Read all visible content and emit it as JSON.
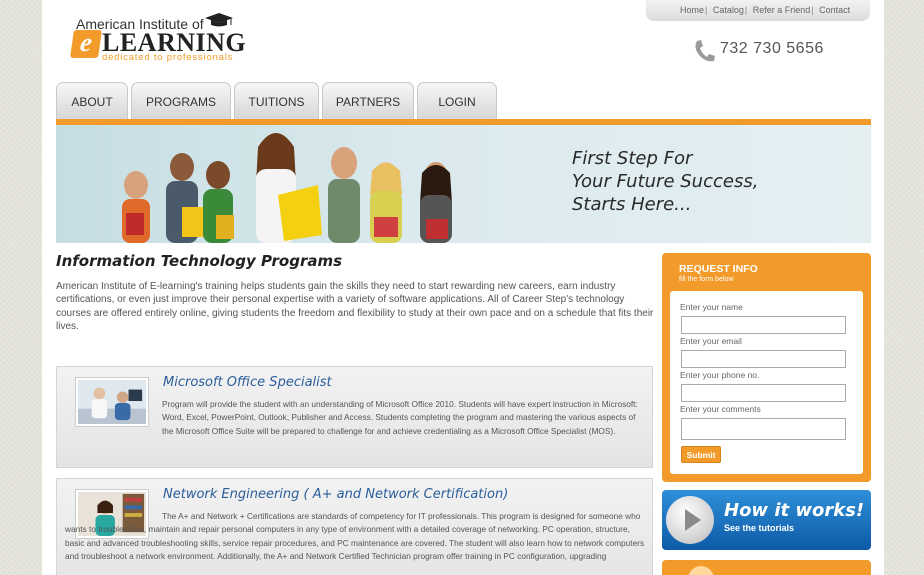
{
  "logo": {
    "top": "American Institute of",
    "e": "e",
    "main": "LEARNING",
    "sub": "dedicated to professionals"
  },
  "top_links": [
    "Home",
    "Catalog",
    "Refer a Friend",
    "Contact"
  ],
  "top_link_separator": "|",
  "phone": "732 730 5656",
  "nav": [
    "ABOUT",
    "PROGRAMS",
    "TUITIONS",
    "PARTNERS",
    "LOGIN"
  ],
  "banner": {
    "line1": "First Step For",
    "line2": "Your Future Success,",
    "line3": "Starts Here..."
  },
  "main": {
    "title": "Information Technology Programs",
    "intro": "American Institute of E-learning's training helps students gain the skills they need to start rewarding new careers, earn industry certifications, or even just improve their personal expertise with a variety of software applications. All of Career Step's technology courses are offered entirely online, giving students the freedom and flexibility to study at their own pace and on a schedule that fits their lives."
  },
  "programs": [
    {
      "title": "Microsoft Office Specialist",
      "desc": "Program will provide the student with an understanding of Microsoft Office 2010. Students will have expert instruction in Microsoft: Word, Excel, PowerPoint, Outlook, Publisher and Access. Students completing the program and mastering the various aspects of the Microsoft Office Suite will be prepared to challenge for and achieve credentialing as a Microsoft Office Specialist (MOS)."
    },
    {
      "title": "Network Engineering ( A+ and Network Certification)",
      "desc": "The A+ and Network + Certifications are standards of competency for IT professionals. This program is designed for someone who wants to troubleshoot, maintain and repair personal computers in any type of environment with a detailed coverage of networking. PC operation, structure, basic and advanced troubleshooting skills, service repair procedures, and PC maintenance are covered. The student will also learn how to network computers and troubleshoot a network environment. Additionally, the A+ and Network Certified Technician program offer training in PC configuration, upgrading"
    }
  ],
  "request": {
    "title": "REQUEST INFO",
    "subtitle": "fill the form below",
    "fields": [
      {
        "label": "Enter your name",
        "value": ""
      },
      {
        "label": "Enter your email",
        "value": ""
      },
      {
        "label": "Enter your phone no.",
        "value": ""
      },
      {
        "label": "Enter your comments",
        "value": ""
      }
    ],
    "submit": "Submit"
  },
  "how": {
    "title": "How it works!",
    "subtitle": "See the tutorials"
  },
  "colors": {
    "accent": "#f39b2a",
    "link_blue": "#2b5d9b",
    "how_blue": "#0d5aa7"
  }
}
